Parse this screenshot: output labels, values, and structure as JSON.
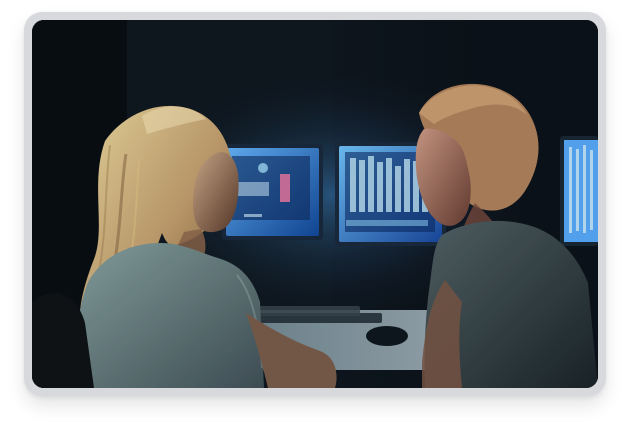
{
  "photo": {
    "subject": "",
    "accent_color": "#4fb6ff",
    "frame_color": "#d7d9dd"
  }
}
